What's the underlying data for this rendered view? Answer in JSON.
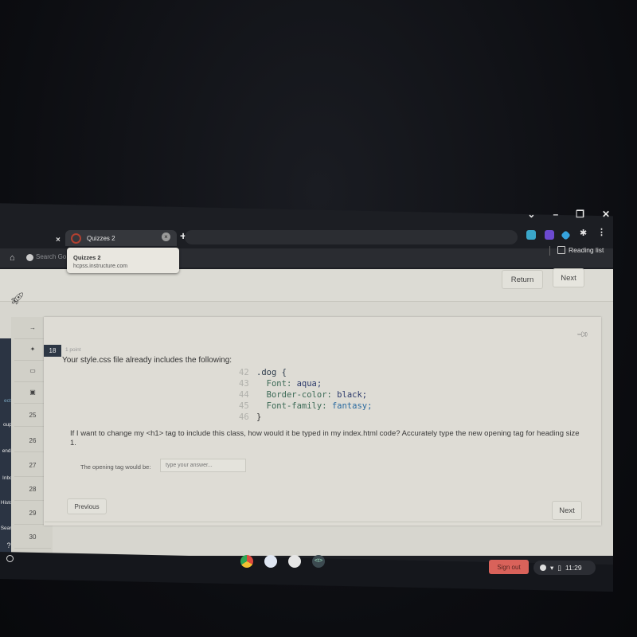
{
  "window_controls": {
    "dropdown": "⌄",
    "minimize": "–",
    "restore": "❐",
    "close": "✕"
  },
  "browser": {
    "tab": {
      "title": "Quizzes 2",
      "close": "×"
    },
    "prev_tab_close": "×",
    "new_tab": "+",
    "tooltip": {
      "title": "Quizzes 2",
      "url": "hcpss.instructure.com"
    },
    "omnibox_placeholder": "Search Go",
    "reading_list": "Reading list",
    "extensions": [
      {
        "name": "download-extension",
        "color": "#3aa6c9"
      },
      {
        "name": "puzzle-game-extension",
        "color": "#6c4ad0"
      },
      {
        "name": "diamond-extension",
        "color": "#36a3dd"
      },
      {
        "name": "extensions-puzzle",
        "color": "#e6e6e6"
      }
    ],
    "menu": "⋮"
  },
  "page": {
    "return_label": "Return",
    "next_top_label": "Next",
    "side_nav": [
      {
        "label": "ects",
        "icon": "courses-icon"
      },
      {
        "label": "oups",
        "icon": "groups-icon"
      },
      {
        "label": "endar",
        "icon": "calendar-icon"
      },
      {
        "label": "Inbox",
        "icon": "inbox-icon"
      },
      {
        "label": "History",
        "icon": "history-icon"
      },
      {
        "label": "Search",
        "icon": "search-icon"
      },
      {
        "label": "?",
        "icon": "help-icon"
      }
    ],
    "question_nav": [
      "25",
      "26",
      "27",
      "28",
      "29",
      "30"
    ],
    "question": {
      "number": "18",
      "points": "1 point",
      "intro": "Your style.css file already includes the following:",
      "code": [
        {
          "ln": "42",
          "text": ".dog {"
        },
        {
          "ln": "43",
          "prop": "Font:",
          "val": "aqua;"
        },
        {
          "ln": "44",
          "prop": "Border-color:",
          "val": "black;"
        },
        {
          "ln": "45",
          "prop": "Font-family:",
          "val": "fantasy;"
        },
        {
          "ln": "46",
          "text": "}"
        }
      ],
      "prompt": "If I want to change my <h1> tag to include this class, how would it be typed in my index.html code? Accurately type the new opening tag for heading size 1.",
      "answer_label": "The opening tag would be:",
      "answer_value": "",
      "answer_placeholder": "type your answer..."
    },
    "previous_label": "Previous",
    "next_bottom_label": "Next"
  },
  "shelf": {
    "apps": [
      {
        "name": "chrome-app",
        "color": "#dd4b3e"
      },
      {
        "name": "docs-app",
        "color": "#4a7ee0"
      },
      {
        "name": "play-store-app",
        "color": "#2fb36b"
      },
      {
        "name": "text-app",
        "color": "#3c4a50",
        "label": "<t>"
      }
    ],
    "sign_out": "Sign out",
    "time": "11:29"
  }
}
